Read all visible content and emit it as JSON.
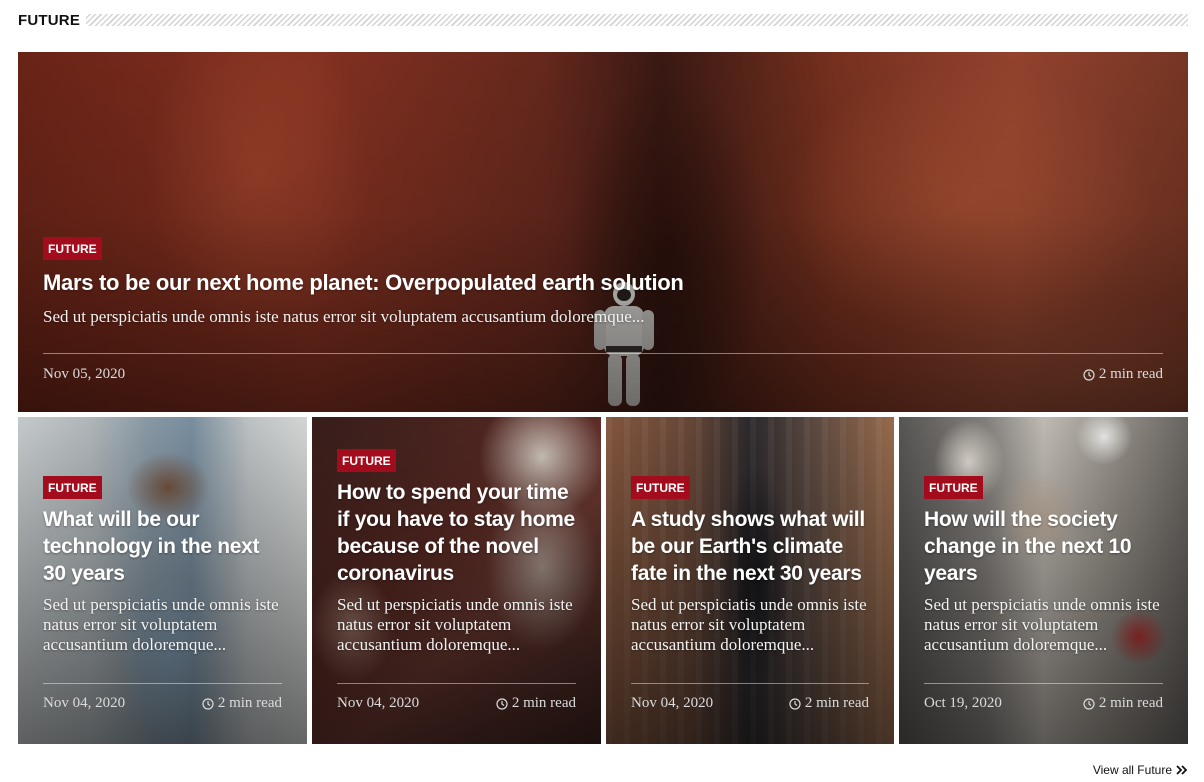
{
  "section": {
    "title": "FUTURE"
  },
  "hero": {
    "category": "FUTURE",
    "title": "Mars to be our next home planet: Overpopulated earth solution",
    "excerpt": "Sed ut perspiciatis unde omnis iste natus error sit voluptatem accusantium doloremque...",
    "date": "Nov 05, 2020",
    "read_time": "2 min read"
  },
  "cards": [
    {
      "category": "FUTURE",
      "title": "What will be our technology in the next 30 years",
      "excerpt": "Sed ut perspiciatis unde omnis iste natus error sit voluptatem accusantium doloremque...",
      "date": "Nov 04, 2020",
      "read_time": "2 min read"
    },
    {
      "category": "FUTURE",
      "title": "How to spend your time if you have to stay home because of the novel coronavirus",
      "excerpt": "Sed ut perspiciatis unde omnis iste natus error sit voluptatem accusantium doloremque...",
      "date": "Nov 04, 2020",
      "read_time": "2 min read"
    },
    {
      "category": "FUTURE",
      "title": "A study shows what will be our Earth's climate fate in the next 30 years",
      "excerpt": "Sed ut perspiciatis unde omnis iste natus error sit voluptatem accusantium doloremque...",
      "date": "Nov 04, 2020",
      "read_time": "2 min read"
    },
    {
      "category": "FUTURE",
      "title": "How will the society change in the next 10 years",
      "excerpt": "Sed ut perspiciatis unde omnis iste natus error sit voluptatem accusantium doloremque...",
      "date": "Oct 19, 2020",
      "read_time": "2 min read"
    }
  ],
  "footer": {
    "view_all_label": "View all Future",
    "view_all_icon": "double-chevron-right-icon"
  },
  "colors": {
    "badge": "#a30c1c",
    "stripes": "#d4d4d4"
  }
}
